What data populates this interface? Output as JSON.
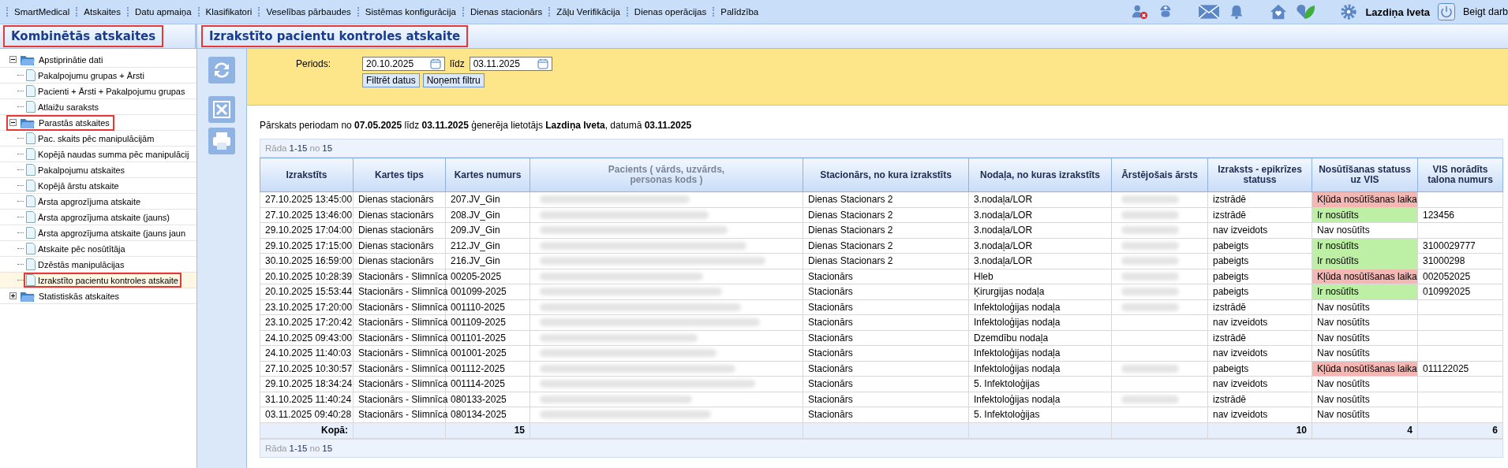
{
  "menu": [
    "SmartMedical",
    "Atskaites",
    "Datu apmaiņa",
    "Klasifikatori",
    "Veselības pārbaudes",
    "Sistēmas konfigurācija",
    "Dienas stacionārs",
    "Zāļu Verifikācija",
    "Dienas operācijas",
    "Palīdzība"
  ],
  "user": {
    "name": "Lazdiņa Iveta",
    "logout": "Beigt darb"
  },
  "sidebar": {
    "title": "Kombinētās atskaites",
    "highlighted": true,
    "tree": [
      {
        "label": "Apstiprinātie dati",
        "expanded": true,
        "highlighted": false,
        "children": [
          {
            "label": "Pakalpojumu grupas + Ārsti",
            "selected": false,
            "highlighted": false
          },
          {
            "label": "Pacienti + Ārsti + Pakalpojumu grupas",
            "selected": false,
            "highlighted": false
          },
          {
            "label": "Atlaižu saraksts",
            "selected": false,
            "highlighted": false
          }
        ]
      },
      {
        "label": "Parastās atskaites",
        "expanded": true,
        "highlighted": true,
        "children": [
          {
            "label": "Pac. skaits pēc manipulācijām",
            "selected": false,
            "highlighted": false
          },
          {
            "label": "Kopējā naudas summa pēc manipulācij",
            "selected": false,
            "highlighted": false
          },
          {
            "label": "Pakalpojumu atskaites",
            "selected": false,
            "highlighted": false
          },
          {
            "label": "Kopējā ārstu atskaite",
            "selected": false,
            "highlighted": false
          },
          {
            "label": "Ārsta apgrozījuma atskaite",
            "selected": false,
            "highlighted": false
          },
          {
            "label": "Ārsta apgrozījuma atskaite (jauns)",
            "selected": false,
            "highlighted": false
          },
          {
            "label": "Ārsta apgrozījuma atskaite (jauns jaun",
            "selected": false,
            "highlighted": false
          },
          {
            "label": "Atskaite pēc nosūtītāja",
            "selected": false,
            "highlighted": false
          },
          {
            "label": "Dzēstās manipulācijas",
            "selected": false,
            "highlighted": false
          },
          {
            "label": "Izrakstīto pacientu kontroles atskaite",
            "selected": true,
            "highlighted": true
          }
        ]
      },
      {
        "label": "Statistiskās atskaites",
        "expanded": false,
        "highlighted": false
      }
    ]
  },
  "content": {
    "title": "Izrakstīto pacientu kontroles atskaite",
    "highlighted": true,
    "filter": {
      "label": "Periods:",
      "from": "20.10.2025",
      "to_label": "līdz",
      "to": "03.11.2025",
      "buttons": [
        "Filtrēt datus",
        "Noņemt filtru"
      ]
    },
    "summary": "Pārskats periodam no **07.05.2025** līdz **03.11.2025** ģenerēja lietotājs **Lazdiņa Iveta**, datumā **03.11.2025**",
    "pager_top": {
      "label": "Rāda",
      "range": "1-15",
      "of": "no",
      "total": "15"
    },
    "table": {
      "columns": [
        {
          "title": "Izrakstīts",
          "muted": false
        },
        {
          "title": "Kartes tips",
          "muted": false
        },
        {
          "title": "Kartes numurs",
          "muted": false
        },
        {
          "title": "Pacients ( vārds, uzvārds, personas kods )",
          "muted": true
        },
        {
          "title": "Stacionārs, no kura izrakstīts",
          "muted": false
        },
        {
          "title": "Nodaļa, no kuras izrakstīts",
          "muted": false
        },
        {
          "title": "Ārstējošais ārsts",
          "muted": false
        },
        {
          "title": "Izraksts - epikrīzes statuss",
          "muted": false
        },
        {
          "title": "Nosūtīšanas statuss uz VIS",
          "muted": false
        },
        {
          "title": "VIS norādīts talona numurs",
          "muted": false
        }
      ],
      "rows": [
        {
          "discharged": "27.10.2025 13:45:00",
          "card_type": "Dienas stacionārs",
          "card_no": "207.JV_Gin",
          "ward": "Dienas Stacionars 2",
          "department": "3.nodaļa/LOR",
          "doctor_redacted": true,
          "epicrisis": "izstrādē",
          "status": "Kļūda nosūtīšanas laika",
          "color": "#f4b7b3"
        },
        {
          "discharged": "27.10.2025 13:46:00",
          "card_type": "Dienas stacionārs",
          "card_no": "208.JV_Gin",
          "ward": "Dienas Stacionars 2",
          "department": "3.nodaļa/LOR",
          "doctor_redacted": true,
          "epicrisis": "izstrādē",
          "status": "Ir nosūtīts",
          "color": "#bdf0a5",
          "vis_no": "123456"
        },
        {
          "discharged": "29.10.2025 17:04:00",
          "card_type": "Dienas stacionārs",
          "card_no": "209.JV_Gin",
          "ward": "Dienas Stacionars 2",
          "department": "3.nodaļa/LOR",
          "doctor_redacted": true,
          "epicrisis": "nav izveidots",
          "status": "Nav nosūtīts"
        },
        {
          "discharged": "29.10.2025 17:15:00",
          "card_type": "Dienas stacionārs",
          "card_no": "212.JV_Gin",
          "ward": "Dienas Stacionars 2",
          "department": "3.nodaļa/LOR",
          "doctor_redacted": true,
          "epicrisis": "pabeigts",
          "status": "Ir nosūtīts",
          "color": "#bdf0a5",
          "vis_no": "3100029777"
        },
        {
          "discharged": "30.10.2025 16:59:00",
          "card_type": "Dienas stacionārs",
          "card_no": "216.JV_Gin",
          "ward": "Dienas Stacionars 2",
          "department": "3.nodaļa/LOR",
          "doctor_redacted": true,
          "epicrisis": "pabeigts",
          "status": "Ir nosūtīts",
          "color": "#bdf0a5",
          "vis_no": "31000298"
        },
        {
          "discharged": "20.10.2025 10:28:39",
          "card_type": "Stacionārs - Slimnīca",
          "card_no": "00205-2025",
          "ward": "Stacionārs",
          "department": "Hleb",
          "doctor_redacted": true,
          "epicrisis": "pabeigts",
          "status": "Kļūda nosūtīšanas laika",
          "color": "#f4b7b3",
          "vis_no": "002052025"
        },
        {
          "discharged": "20.10.2025 15:53:44",
          "card_type": "Stacionārs - Slimnīca",
          "card_no": "001099-2025",
          "ward": "Stacionārs",
          "department": "Ķirurgijas nodaļa",
          "doctor_redacted": true,
          "epicrisis": "pabeigts",
          "status": "Ir nosūtīts",
          "color": "#bdf0a5",
          "vis_no": "010992025"
        },
        {
          "discharged": "23.10.2025 17:20:00",
          "card_type": "Stacionārs - Slimnīca",
          "card_no": "001110-2025",
          "ward": "Stacionārs",
          "department": "Infektoloģijas nodaļa",
          "doctor_redacted": true,
          "epicrisis": "izstrādē",
          "status": "Nav nosūtīts"
        },
        {
          "discharged": "23.10.2025 17:20:42",
          "card_type": "Stacionārs - Slimnīca",
          "card_no": "001109-2025",
          "ward": "Stacionārs",
          "department": "Infektoloģijas nodaļa",
          "doctor_redacted": false,
          "epicrisis": "nav izveidots",
          "status": "Nav nosūtīts"
        },
        {
          "discharged": "24.10.2025 09:43:00",
          "card_type": "Stacionārs - Slimnīca",
          "card_no": "001101-2025",
          "ward": "Stacionārs",
          "department": "Dzemdību nodaļa",
          "doctor_redacted": false,
          "epicrisis": "izstrādē",
          "status": "Nav nosūtīts"
        },
        {
          "discharged": "24.10.2025 11:40:03",
          "card_type": "Stacionārs - Slimnīca",
          "card_no": "001001-2025",
          "ward": "Stacionārs",
          "department": "Infektoloģijas nodaļa",
          "doctor_redacted": false,
          "epicrisis": "nav izveidots",
          "status": "Nav nosūtīts"
        },
        {
          "discharged": "27.10.2025 10:30:57",
          "card_type": "Stacionārs - Slimnīca",
          "card_no": "001112-2025",
          "ward": "Stacionārs",
          "department": "Infektoloģijas nodaļa",
          "doctor_redacted": true,
          "epicrisis": "pabeigts",
          "status": "Kļūda nosūtīšanas laika",
          "color": "#f4b7b3",
          "vis_no": "011122025"
        },
        {
          "discharged": "29.10.2025 18:34:24",
          "card_type": "Stacionārs - Slimnīca",
          "card_no": "001114-2025",
          "ward": "Stacionārs",
          "department": "5. Infektoloģijas",
          "doctor_redacted": false,
          "epicrisis": "nav izveidots",
          "status": "Nav nosūtīts"
        },
        {
          "discharged": "31.10.2025 11:40:24",
          "card_type": "Stacionārs - Slimnīca",
          "card_no": "080133-2025",
          "ward": "Stacionārs",
          "department": "Infektoloģijas nodaļa",
          "doctor_redacted": true,
          "epicrisis": "izstrādē",
          "status": "Nav nosūtīts"
        },
        {
          "discharged": "03.11.2025 09:40:28",
          "card_type": "Stacionārs - Slimnīca",
          "card_no": "080134-2025",
          "ward": "Stacionārs",
          "department": "5. Infektoloģijas",
          "doctor_redacted": false,
          "epicrisis": "nav izveidots",
          "status": "Nav nosūtīts"
        }
      ],
      "totals": {
        "label": "Kopā:",
        "card_no": "15",
        "epicrisis": "10",
        "status": "4",
        "vis_no": "6"
      }
    },
    "pager_bottom": {
      "label": "Rāda",
      "range": "1-15",
      "of": "no",
      "total": "15"
    }
  }
}
